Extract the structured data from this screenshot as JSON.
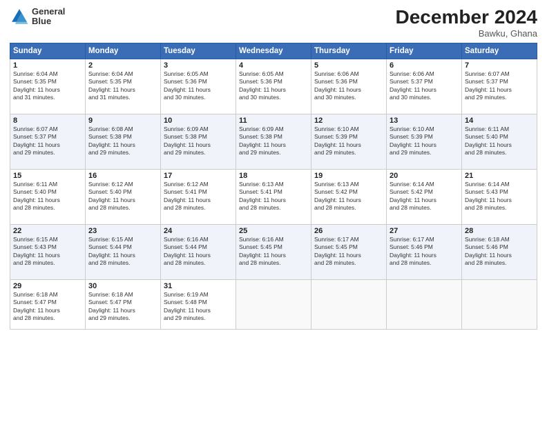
{
  "logo": {
    "line1": "General",
    "line2": "Blue"
  },
  "title": "December 2024",
  "location": "Bawku, Ghana",
  "days_of_week": [
    "Sunday",
    "Monday",
    "Tuesday",
    "Wednesday",
    "Thursday",
    "Friday",
    "Saturday"
  ],
  "weeks": [
    [
      {
        "day": "1",
        "sunrise": "6:04 AM",
        "sunset": "5:35 PM",
        "daylight": "11 hours and 31 minutes."
      },
      {
        "day": "2",
        "sunrise": "6:04 AM",
        "sunset": "5:35 PM",
        "daylight": "11 hours and 31 minutes."
      },
      {
        "day": "3",
        "sunrise": "6:05 AM",
        "sunset": "5:36 PM",
        "daylight": "11 hours and 30 minutes."
      },
      {
        "day": "4",
        "sunrise": "6:05 AM",
        "sunset": "5:36 PM",
        "daylight": "11 hours and 30 minutes."
      },
      {
        "day": "5",
        "sunrise": "6:06 AM",
        "sunset": "5:36 PM",
        "daylight": "11 hours and 30 minutes."
      },
      {
        "day": "6",
        "sunrise": "6:06 AM",
        "sunset": "5:37 PM",
        "daylight": "11 hours and 30 minutes."
      },
      {
        "day": "7",
        "sunrise": "6:07 AM",
        "sunset": "5:37 PM",
        "daylight": "11 hours and 29 minutes."
      }
    ],
    [
      {
        "day": "8",
        "sunrise": "6:07 AM",
        "sunset": "5:37 PM",
        "daylight": "11 hours and 29 minutes."
      },
      {
        "day": "9",
        "sunrise": "6:08 AM",
        "sunset": "5:38 PM",
        "daylight": "11 hours and 29 minutes."
      },
      {
        "day": "10",
        "sunrise": "6:09 AM",
        "sunset": "5:38 PM",
        "daylight": "11 hours and 29 minutes."
      },
      {
        "day": "11",
        "sunrise": "6:09 AM",
        "sunset": "5:38 PM",
        "daylight": "11 hours and 29 minutes."
      },
      {
        "day": "12",
        "sunrise": "6:10 AM",
        "sunset": "5:39 PM",
        "daylight": "11 hours and 29 minutes."
      },
      {
        "day": "13",
        "sunrise": "6:10 AM",
        "sunset": "5:39 PM",
        "daylight": "11 hours and 29 minutes."
      },
      {
        "day": "14",
        "sunrise": "6:11 AM",
        "sunset": "5:40 PM",
        "daylight": "11 hours and 28 minutes."
      }
    ],
    [
      {
        "day": "15",
        "sunrise": "6:11 AM",
        "sunset": "5:40 PM",
        "daylight": "11 hours and 28 minutes."
      },
      {
        "day": "16",
        "sunrise": "6:12 AM",
        "sunset": "5:40 PM",
        "daylight": "11 hours and 28 minutes."
      },
      {
        "day": "17",
        "sunrise": "6:12 AM",
        "sunset": "5:41 PM",
        "daylight": "11 hours and 28 minutes."
      },
      {
        "day": "18",
        "sunrise": "6:13 AM",
        "sunset": "5:41 PM",
        "daylight": "11 hours and 28 minutes."
      },
      {
        "day": "19",
        "sunrise": "6:13 AM",
        "sunset": "5:42 PM",
        "daylight": "11 hours and 28 minutes."
      },
      {
        "day": "20",
        "sunrise": "6:14 AM",
        "sunset": "5:42 PM",
        "daylight": "11 hours and 28 minutes."
      },
      {
        "day": "21",
        "sunrise": "6:14 AM",
        "sunset": "5:43 PM",
        "daylight": "11 hours and 28 minutes."
      }
    ],
    [
      {
        "day": "22",
        "sunrise": "6:15 AM",
        "sunset": "5:43 PM",
        "daylight": "11 hours and 28 minutes."
      },
      {
        "day": "23",
        "sunrise": "6:15 AM",
        "sunset": "5:44 PM",
        "daylight": "11 hours and 28 minutes."
      },
      {
        "day": "24",
        "sunrise": "6:16 AM",
        "sunset": "5:44 PM",
        "daylight": "11 hours and 28 minutes."
      },
      {
        "day": "25",
        "sunrise": "6:16 AM",
        "sunset": "5:45 PM",
        "daylight": "11 hours and 28 minutes."
      },
      {
        "day": "26",
        "sunrise": "6:17 AM",
        "sunset": "5:45 PM",
        "daylight": "11 hours and 28 minutes."
      },
      {
        "day": "27",
        "sunrise": "6:17 AM",
        "sunset": "5:46 PM",
        "daylight": "11 hours and 28 minutes."
      },
      {
        "day": "28",
        "sunrise": "6:18 AM",
        "sunset": "5:46 PM",
        "daylight": "11 hours and 28 minutes."
      }
    ],
    [
      {
        "day": "29",
        "sunrise": "6:18 AM",
        "sunset": "5:47 PM",
        "daylight": "11 hours and 28 minutes."
      },
      {
        "day": "30",
        "sunrise": "6:18 AM",
        "sunset": "5:47 PM",
        "daylight": "11 hours and 29 minutes."
      },
      {
        "day": "31",
        "sunrise": "6:19 AM",
        "sunset": "5:48 PM",
        "daylight": "11 hours and 29 minutes."
      },
      null,
      null,
      null,
      null
    ]
  ]
}
